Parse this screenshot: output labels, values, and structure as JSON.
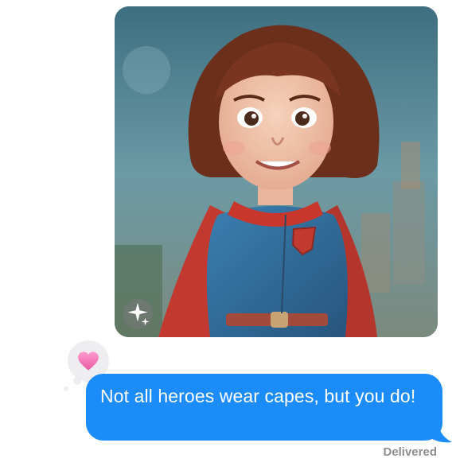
{
  "message": {
    "text": "Not all heroes wear capes, but you do!",
    "status": "Delivered",
    "bubble_color": "#1b8cf9"
  },
  "image_attachment": {
    "icon": "sparkles-icon"
  },
  "tapback": {
    "icon": "heart-icon",
    "color": "#f07ab8"
  }
}
